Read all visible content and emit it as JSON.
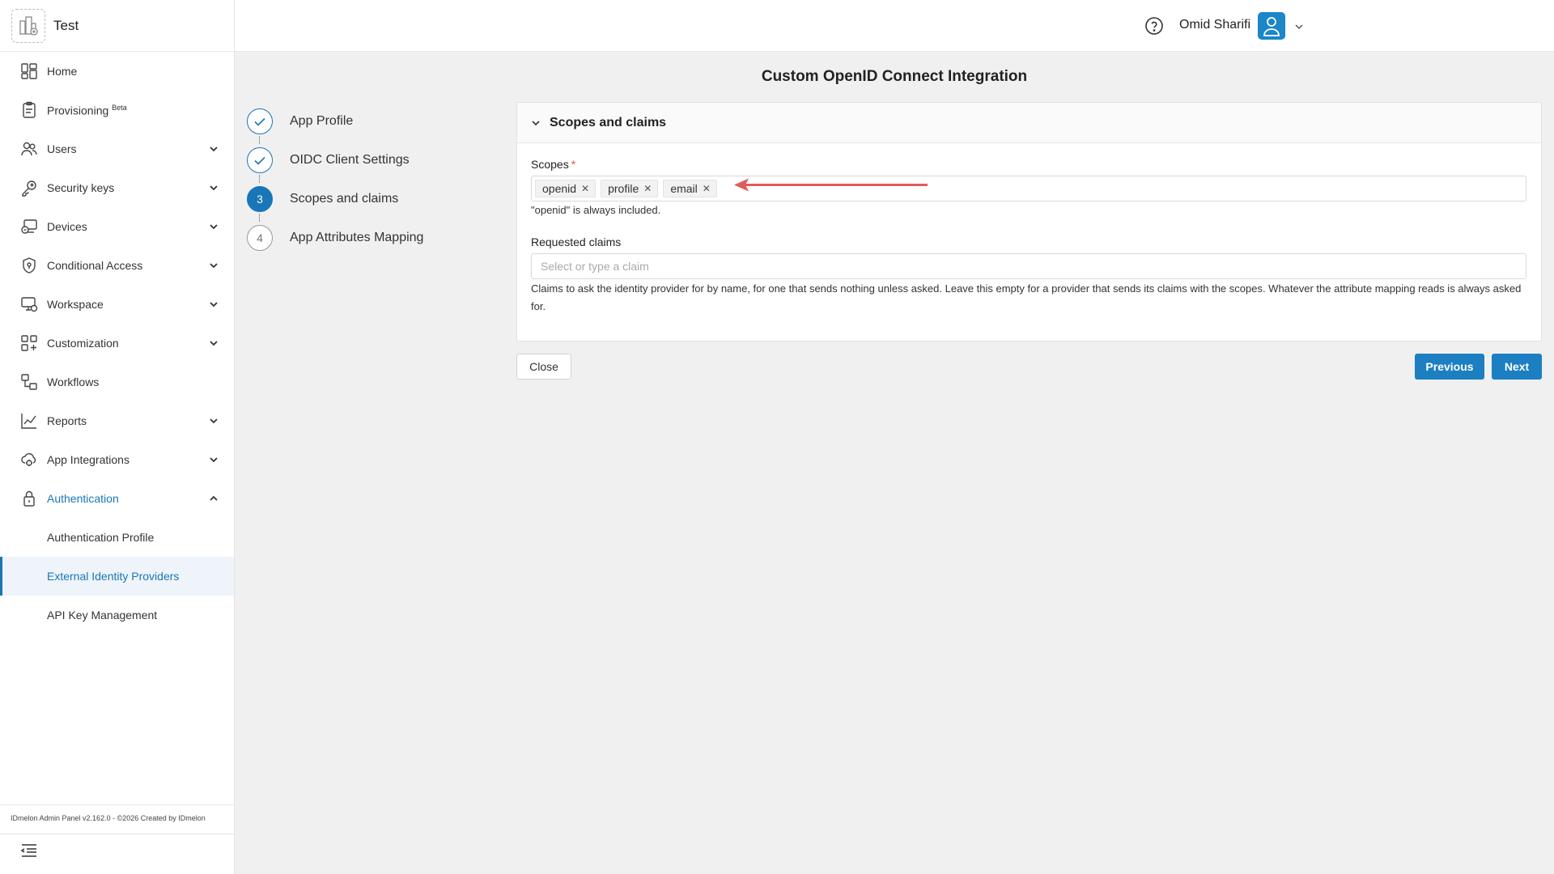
{
  "brand": {
    "name": "Test"
  },
  "header": {
    "user_name": "Omid Sharifi"
  },
  "sidebar": {
    "items": [
      {
        "label": "Home",
        "has_chevron": false
      },
      {
        "label": "Provisioning",
        "badge": "Beta",
        "has_chevron": false
      },
      {
        "label": "Users",
        "has_chevron": true
      },
      {
        "label": "Security keys",
        "has_chevron": true
      },
      {
        "label": "Devices",
        "has_chevron": true
      },
      {
        "label": "Conditional Access",
        "has_chevron": true
      },
      {
        "label": "Workspace",
        "has_chevron": true
      },
      {
        "label": "Customization",
        "has_chevron": true
      },
      {
        "label": "Workflows",
        "has_chevron": false
      },
      {
        "label": "Reports",
        "has_chevron": true
      },
      {
        "label": "App Integrations",
        "has_chevron": true
      },
      {
        "label": "Authentication",
        "has_chevron": true,
        "expanded": true
      }
    ],
    "sub_items": [
      {
        "label": "Authentication Profile",
        "active": false
      },
      {
        "label": "External Identity Providers",
        "active": true
      },
      {
        "label": "API Key Management",
        "active": false
      }
    ],
    "footer": "IDmelon Admin Panel v2.162.0 - ©2026 Created by IDmelon"
  },
  "page": {
    "title": "Custom OpenID Connect Integration"
  },
  "steps": [
    {
      "number": "1",
      "label": "App Profile",
      "state": "done"
    },
    {
      "number": "2",
      "label": "OIDC Client Settings",
      "state": "done"
    },
    {
      "number": "3",
      "label": "Scopes and claims",
      "state": "active"
    },
    {
      "number": "4",
      "label": "App Attributes Mapping",
      "state": "pending"
    }
  ],
  "section": {
    "title": "Scopes and claims",
    "scopes_label": "Scopes",
    "scopes_required_mark": "*",
    "scopes": [
      "openid",
      "profile",
      "email"
    ],
    "scopes_hint": "\"openid\" is always included.",
    "claims_label": "Requested claims",
    "claims_placeholder": "Select or type a claim",
    "claims_help": "Claims to ask the identity provider for by name, for one that sends nothing unless asked. Leave this empty for a provider that sends its claims with the scopes. Whatever the attribute mapping reads is always asked for."
  },
  "buttons": {
    "close": "Close",
    "previous": "Previous",
    "next": "Next"
  },
  "colors": {
    "accent": "#1976b8",
    "button": "#1b7fc2",
    "required": "#e05555",
    "arrow": "#e25b5b"
  }
}
